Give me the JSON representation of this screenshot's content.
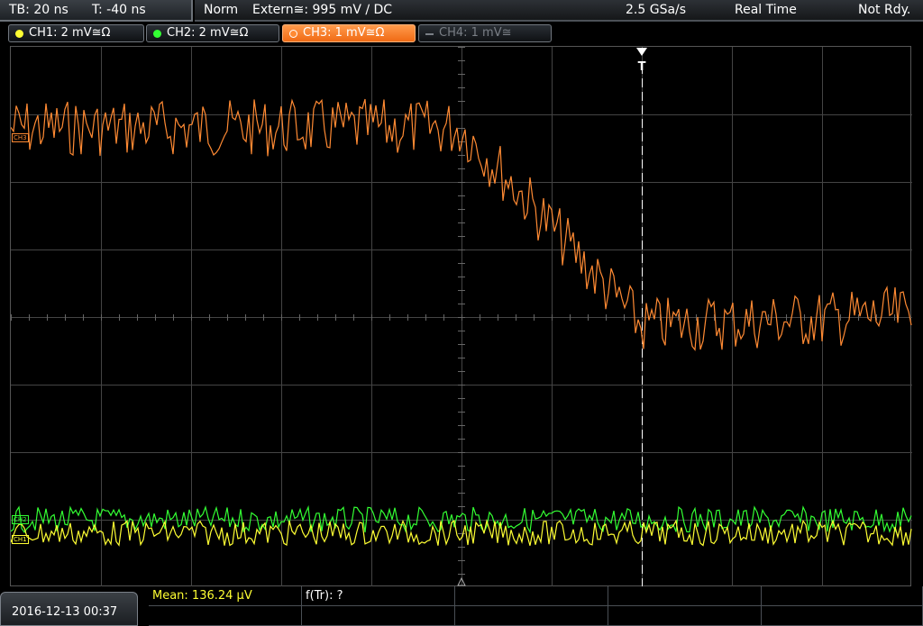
{
  "status": {
    "timebase": "TB: 20 ns",
    "trigger_time": "T: -40 ns",
    "mode": "Norm",
    "trigger_source": "Extern≅: 995 mV ∕ DC",
    "sample_rate": "2.5 GSa/s",
    "acquisition": "Real Time",
    "state": "Not Rdy."
  },
  "channels": [
    {
      "label": "CH1: 2 mV≅Ω",
      "color": "#ffff33",
      "active": false,
      "enabled": true
    },
    {
      "label": "CH2: 2 mV≅Ω",
      "color": "#33ff33",
      "active": false,
      "enabled": true
    },
    {
      "label": "CH3: 1 mV≅Ω",
      "color": "#ff8a33",
      "active": true,
      "enabled": true
    },
    {
      "label": "CH4: 1 mV≅",
      "color": "#7a7f86",
      "active": false,
      "enabled": false
    }
  ],
  "markers": {
    "ch3": "CH3",
    "ch2": "CH2",
    "ch1": "CH1",
    "trigger": "T"
  },
  "bottom": {
    "datetime": "2016-12-13 00:37",
    "mean": "Mean: 136.24 µV",
    "rise": "f(Tr): ?"
  },
  "colors": {
    "ch1": "#ffff33",
    "ch2": "#33ff33",
    "ch3": "#ff8a33",
    "grid": "#444444",
    "active_tab": "#f37a22",
    "measurement_text": "#ffff33"
  }
}
